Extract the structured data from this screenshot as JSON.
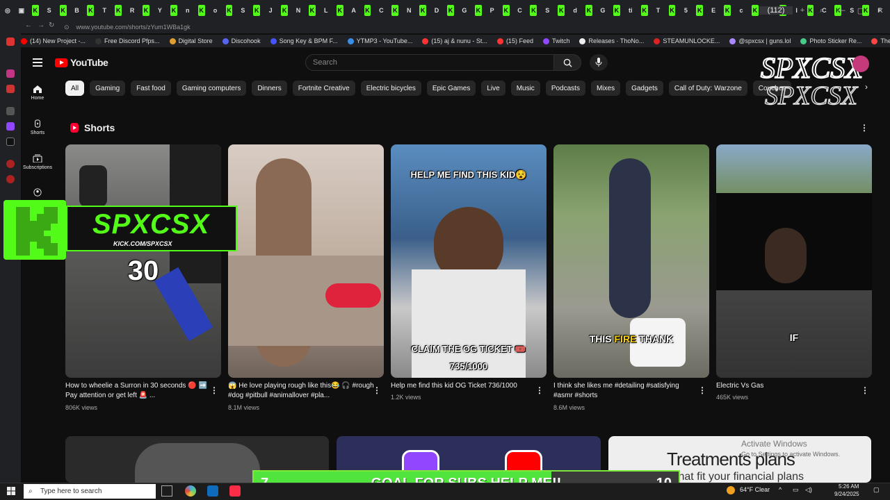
{
  "browser": {
    "url": "www.youtube.com/shorts/zYum1WBa1gk",
    "active_tab_title": "(112)",
    "tab_letters": [
      "K",
      "S",
      "K",
      "B",
      "K",
      "T",
      "K",
      "R",
      "K",
      "Y",
      "K",
      "n",
      "K",
      "o",
      "K",
      "S",
      "K",
      "J",
      "K",
      "N",
      "K",
      "L",
      "K",
      "A",
      "K",
      "C",
      "K",
      "N",
      "K",
      "D",
      "K",
      "G",
      "K",
      "P",
      "K",
      "C",
      "K",
      "S",
      "K",
      "d",
      "K",
      "G",
      "K",
      "ti",
      "K",
      "T",
      "K",
      "5",
      "K",
      "E",
      "K",
      "c",
      "K",
      "N",
      "K",
      "I",
      "K",
      "C",
      "K",
      "S",
      "K",
      "F"
    ],
    "bookmarks": [
      {
        "label": "(14) New Project -...",
        "color": "#ff0000"
      },
      {
        "label": "Free Discord Pfps...",
        "color": "#333333"
      },
      {
        "label": "Digital Store",
        "color": "#e0a030"
      },
      {
        "label": "Discohook",
        "color": "#5865f2"
      },
      {
        "label": "Song Key & BPM F...",
        "color": "#4455ff"
      },
      {
        "label": "YTMP3 - YouTube...",
        "color": "#3a8ee6"
      },
      {
        "label": "(15) aj & nunu - St...",
        "color": "#ff3333"
      },
      {
        "label": "(15) Feed",
        "color": "#ff3333"
      },
      {
        "label": "Twitch",
        "color": "#9146ff"
      },
      {
        "label": "Releases · ThoNo...",
        "color": "#eeeeee"
      },
      {
        "label": "STEAMUNLOCKE...",
        "color": "#dd2222"
      },
      {
        "label": "@spxcsx | guns.lol",
        "color": "#aa88ff"
      },
      {
        "label": "Photo Sticker Re...",
        "color": "#44cc88"
      },
      {
        "label": "TheKM",
        "color": "#ff4444"
      }
    ]
  },
  "youtube": {
    "logo_text": "YouTube",
    "search_placeholder": "Search",
    "chips": [
      "All",
      "Gaming",
      "Fast food",
      "Gaming computers",
      "Dinners",
      "Fortnite Creative",
      "Electric bicycles",
      "Epic Games",
      "Live",
      "Music",
      "Podcasts",
      "Mixes",
      "Gadgets",
      "Call of Duty: Warzone",
      "Couches"
    ],
    "guide": [
      {
        "label": "Home"
      },
      {
        "label": "Shorts"
      },
      {
        "label": "Subscriptions"
      }
    ],
    "shorts_heading": "Shorts",
    "shorts": [
      {
        "title": "How to wheelie a Surron in 30 seconds 🔴 ➡️ Pay attention or get left 🚨 ...",
        "views": "806K views",
        "overlay": "30",
        "bg": "#6b6b66"
      },
      {
        "title": "😱 He love playing rough like this😂 🎧 #rough #dog #pitbull #animallover #pla...",
        "views": "8.1M views",
        "overlay": "",
        "bg": "#b8a89c"
      },
      {
        "title": "Help me find this kid OG Ticket 736/1000",
        "views": "1.2K views",
        "overlay_top": "HELP ME FIND THIS KID😵",
        "overlay_bottom": "CLAIM THE OG TICKET 🎟️",
        "overlay_count": "735/1000",
        "bg": "#4a7aa8"
      },
      {
        "title": "I think she likes me #detailing #satisfying #asmr #shorts",
        "views": "8.6M views",
        "overlay_a": "THIS",
        "overlay_b": "FIRE",
        "overlay_c": "THANK",
        "bg": "#6d8a5a"
      },
      {
        "title": "Electric Vs Gas",
        "views": "465K views",
        "overlay": "IF",
        "bg": "#7a8a6a"
      }
    ],
    "row2": [
      {
        "bg": "#2a2a2a",
        "text": ""
      },
      {
        "bg": "#2c2f5a",
        "text": ""
      },
      {
        "bg": "#eeeeee",
        "text": "Treatments plans",
        "subtext": "that fit your financial plans"
      }
    ]
  },
  "stream": {
    "brand": "SPXCSX",
    "handle": "KICK.COM/SPXCSX",
    "goal_text": "GOAL FOR SUBS HELP ME!!",
    "goal_current": "7",
    "goal_target": "10",
    "goal_progress": 0.7,
    "windows_watermark": "Activate Windows",
    "windows_watermark_sub": "Go to Settings to activate Windows."
  },
  "taskbar": {
    "search_placeholder": "Type here to search",
    "weather": "64°F  Clear",
    "time": "5:26 AM",
    "date": "9/24/2025"
  }
}
